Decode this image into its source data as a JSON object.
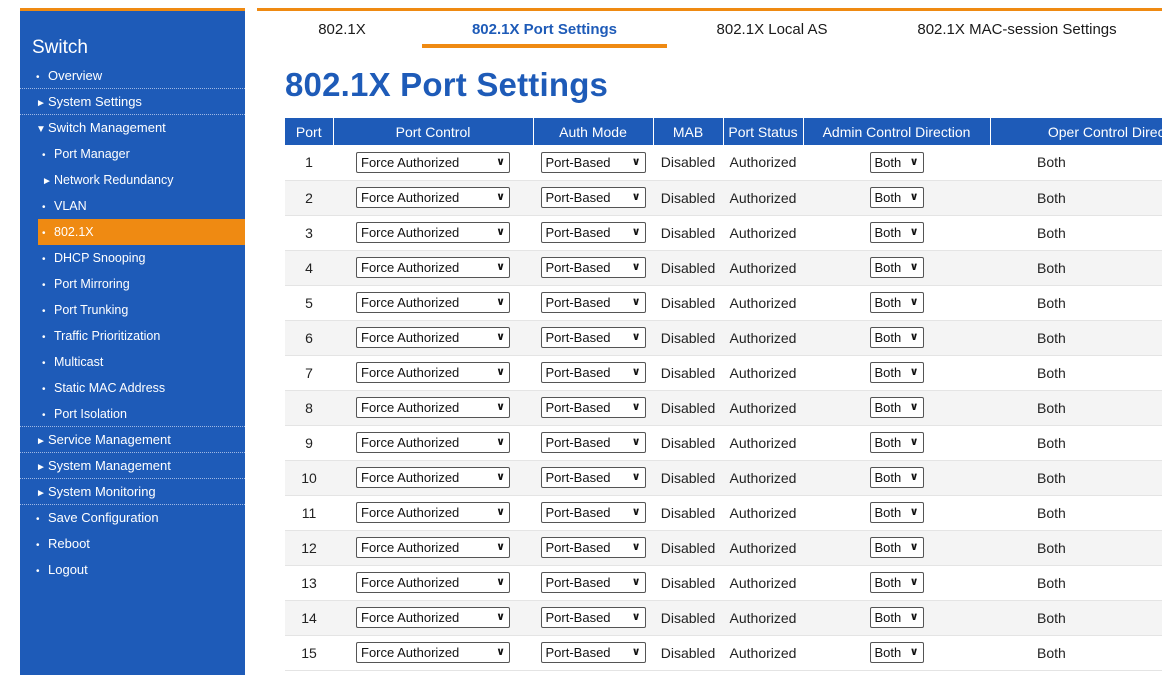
{
  "sidebar": {
    "brand": "Switch",
    "items": [
      {
        "label": "Overview",
        "mark": "•",
        "sub": false,
        "sep": true
      },
      {
        "label": "System Settings",
        "mark": "►",
        "sub": false,
        "sep": true
      },
      {
        "label": "Switch Management",
        "mark": "▼",
        "sub": false,
        "sep": false
      },
      {
        "label": "Port Manager",
        "mark": "•",
        "sub": true,
        "sep": false
      },
      {
        "label": "Network Redundancy",
        "mark": "►",
        "sub": true,
        "sep": false
      },
      {
        "label": "VLAN",
        "mark": "•",
        "sub": true,
        "sep": false
      },
      {
        "label": "802.1X",
        "mark": "•",
        "sub": true,
        "sep": false,
        "active": true
      },
      {
        "label": "DHCP Snooping",
        "mark": "•",
        "sub": true,
        "sep": false
      },
      {
        "label": "Port Mirroring",
        "mark": "•",
        "sub": true,
        "sep": false
      },
      {
        "label": "Port Trunking",
        "mark": "•",
        "sub": true,
        "sep": false
      },
      {
        "label": "Traffic Prioritization",
        "mark": "•",
        "sub": true,
        "sep": false
      },
      {
        "label": "Multicast",
        "mark": "•",
        "sub": true,
        "sep": false
      },
      {
        "label": "Static MAC Address",
        "mark": "•",
        "sub": true,
        "sep": false
      },
      {
        "label": "Port Isolation",
        "mark": "•",
        "sub": true,
        "sep": true
      },
      {
        "label": "Service Management",
        "mark": "►",
        "sub": false,
        "sep": true
      },
      {
        "label": "System Management",
        "mark": "►",
        "sub": false,
        "sep": true
      },
      {
        "label": "System Monitoring",
        "mark": "►",
        "sub": false,
        "sep": true
      },
      {
        "label": "Save Configuration",
        "mark": "•",
        "sub": false,
        "sep": false
      },
      {
        "label": "Reboot",
        "mark": "•",
        "sub": false,
        "sep": false
      },
      {
        "label": "Logout",
        "mark": "•",
        "sub": false,
        "sep": false
      }
    ]
  },
  "tabs": [
    {
      "label": "802.1X",
      "active": false
    },
    {
      "label": "802.1X Port Settings",
      "active": true
    },
    {
      "label": "802.1X Local AS",
      "active": false
    },
    {
      "label": "802.1X MAC-session Settings",
      "active": false
    }
  ],
  "page_title": "802.1X Port Settings",
  "table": {
    "headers": [
      "Port",
      "Port Control",
      "Auth Mode",
      "MAB",
      "Port Status",
      "Admin Control Direction",
      "Oper Control Direction"
    ],
    "rows": [
      {
        "port": "1",
        "port_control": "Force Authorized",
        "auth_mode": "Port-Based",
        "mab": "Disabled",
        "status": "Authorized",
        "admin_dir": "Both",
        "oper_dir": "Both"
      },
      {
        "port": "2",
        "port_control": "Force Authorized",
        "auth_mode": "Port-Based",
        "mab": "Disabled",
        "status": "Authorized",
        "admin_dir": "Both",
        "oper_dir": "Both"
      },
      {
        "port": "3",
        "port_control": "Force Authorized",
        "auth_mode": "Port-Based",
        "mab": "Disabled",
        "status": "Authorized",
        "admin_dir": "Both",
        "oper_dir": "Both"
      },
      {
        "port": "4",
        "port_control": "Force Authorized",
        "auth_mode": "Port-Based",
        "mab": "Disabled",
        "status": "Authorized",
        "admin_dir": "Both",
        "oper_dir": "Both"
      },
      {
        "port": "5",
        "port_control": "Force Authorized",
        "auth_mode": "Port-Based",
        "mab": "Disabled",
        "status": "Authorized",
        "admin_dir": "Both",
        "oper_dir": "Both"
      },
      {
        "port": "6",
        "port_control": "Force Authorized",
        "auth_mode": "Port-Based",
        "mab": "Disabled",
        "status": "Authorized",
        "admin_dir": "Both",
        "oper_dir": "Both"
      },
      {
        "port": "7",
        "port_control": "Force Authorized",
        "auth_mode": "Port-Based",
        "mab": "Disabled",
        "status": "Authorized",
        "admin_dir": "Both",
        "oper_dir": "Both"
      },
      {
        "port": "8",
        "port_control": "Force Authorized",
        "auth_mode": "Port-Based",
        "mab": "Disabled",
        "status": "Authorized",
        "admin_dir": "Both",
        "oper_dir": "Both"
      },
      {
        "port": "9",
        "port_control": "Force Authorized",
        "auth_mode": "Port-Based",
        "mab": "Disabled",
        "status": "Authorized",
        "admin_dir": "Both",
        "oper_dir": "Both"
      },
      {
        "port": "10",
        "port_control": "Force Authorized",
        "auth_mode": "Port-Based",
        "mab": "Disabled",
        "status": "Authorized",
        "admin_dir": "Both",
        "oper_dir": "Both"
      },
      {
        "port": "11",
        "port_control": "Force Authorized",
        "auth_mode": "Port-Based",
        "mab": "Disabled",
        "status": "Authorized",
        "admin_dir": "Both",
        "oper_dir": "Both"
      },
      {
        "port": "12",
        "port_control": "Force Authorized",
        "auth_mode": "Port-Based",
        "mab": "Disabled",
        "status": "Authorized",
        "admin_dir": "Both",
        "oper_dir": "Both"
      },
      {
        "port": "13",
        "port_control": "Force Authorized",
        "auth_mode": "Port-Based",
        "mab": "Disabled",
        "status": "Authorized",
        "admin_dir": "Both",
        "oper_dir": "Both"
      },
      {
        "port": "14",
        "port_control": "Force Authorized",
        "auth_mode": "Port-Based",
        "mab": "Disabled",
        "status": "Authorized",
        "admin_dir": "Both",
        "oper_dir": "Both"
      },
      {
        "port": "15",
        "port_control": "Force Authorized",
        "auth_mode": "Port-Based",
        "mab": "Disabled",
        "status": "Authorized",
        "admin_dir": "Both",
        "oper_dir": "Both"
      }
    ]
  },
  "colors": {
    "accent": "#ef8a12",
    "brand": "#1e5bb8"
  }
}
